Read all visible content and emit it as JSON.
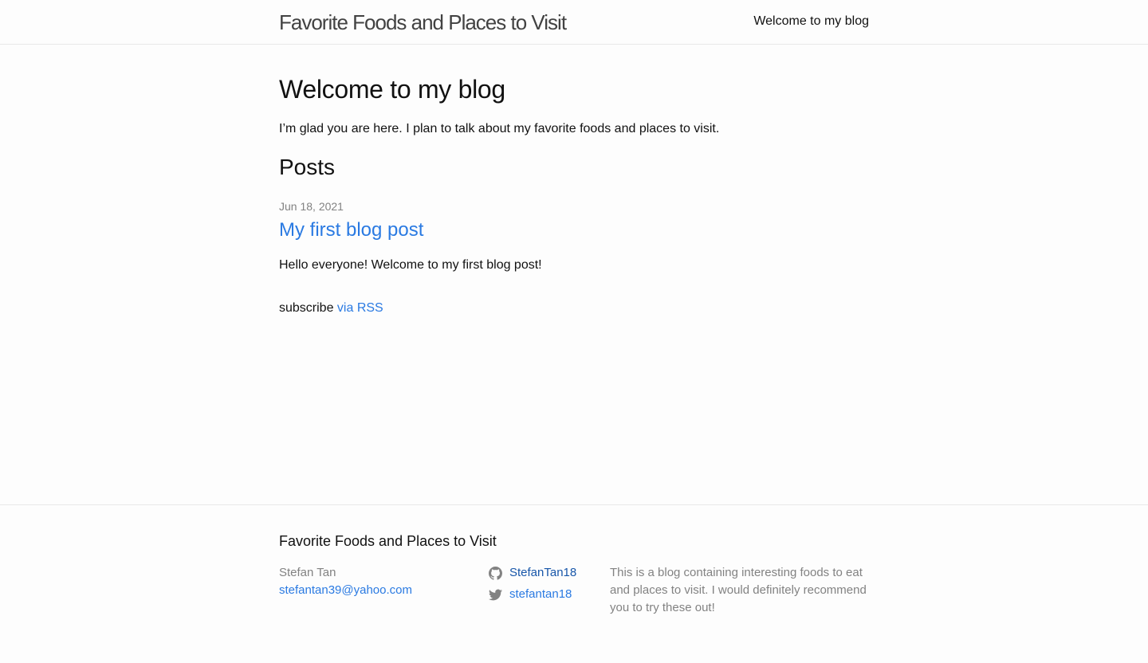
{
  "header": {
    "site_title": "Favorite Foods and Places to Visit",
    "nav_link": "Welcome to my blog"
  },
  "home": {
    "heading": "Welcome to my blog",
    "intro": "I’m glad you are here. I plan to talk about my favorite foods and places to visit.",
    "posts_heading": "Posts",
    "posts": [
      {
        "date": "Jun 18, 2021",
        "title": "My first blog post",
        "excerpt": "Hello everyone! Welcome to my first blog post!"
      }
    ],
    "rss_prefix": "subscribe ",
    "rss_link": "via RSS"
  },
  "footer": {
    "heading": "Favorite Foods and Places to Visit",
    "author_name": "Stefan Tan",
    "email": "stefantan39@yahoo.com",
    "social": [
      {
        "icon": "github-icon",
        "label": "StefanTan18"
      },
      {
        "icon": "twitter-icon",
        "label": "stefantan18"
      }
    ],
    "description": "This is a blog containing interesting foods to eat and places to visit. I would definitely recommend you to try these out!"
  },
  "colors": {
    "background": "#fdfdfd",
    "text": "#111111",
    "link": "#2a7ae2",
    "link_visited": "#1756a9",
    "muted": "#828282",
    "border": "#e8e8e8"
  }
}
